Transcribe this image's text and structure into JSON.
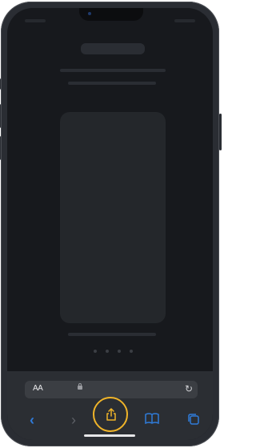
{
  "toolbar": {
    "reader_label": "AA",
    "accent": "#2f7bd9",
    "highlight": "#f0b429"
  },
  "icons": [
    "back-chevron-icon",
    "forward-chevron-icon",
    "share-icon",
    "bookmarks-icon",
    "tabs-icon",
    "lock-icon",
    "reload-icon"
  ]
}
